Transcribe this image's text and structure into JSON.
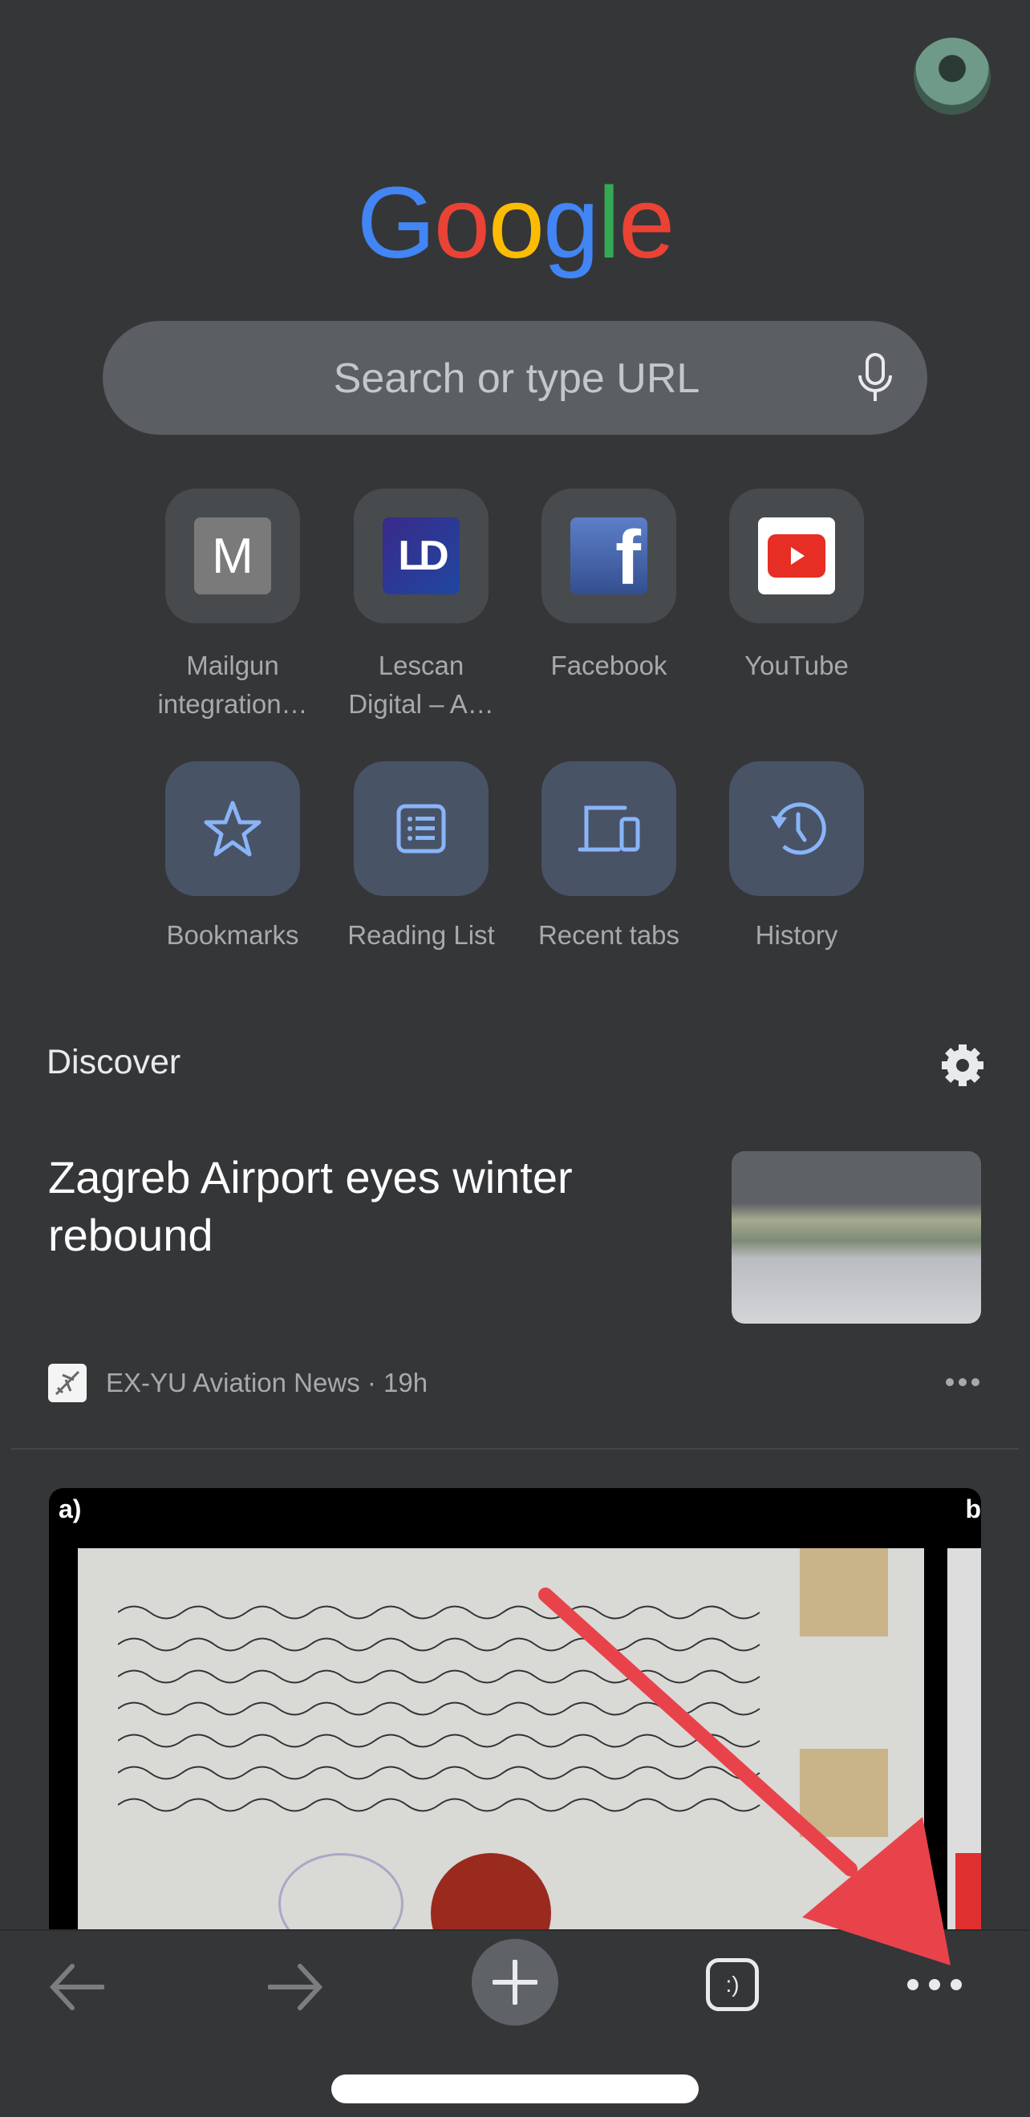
{
  "header": {
    "avatar_label": "Profile"
  },
  "logo": {
    "letters": [
      "G",
      "o",
      "o",
      "g",
      "l",
      "e"
    ],
    "colors": [
      "#4285f4",
      "#ea4335",
      "#fbbc05",
      "#4285f4",
      "#34a853",
      "#ea4335"
    ]
  },
  "search": {
    "placeholder": "Search or type URL",
    "icon": "microphone-icon"
  },
  "shortcuts": [
    {
      "label": "Mailgun integration…",
      "line1": "Mailgun",
      "line2": "integration…",
      "glyph": "M"
    },
    {
      "label": "Lescan Digital – A…",
      "line1": "Lescan",
      "line2": "Digital – A…",
      "glyph": "LD"
    },
    {
      "label": "Facebook",
      "line1": "Facebook",
      "line2": "",
      "glyph": "f"
    },
    {
      "label": "YouTube",
      "line1": "YouTube",
      "line2": "",
      "glyph": "youtube-play-icon"
    }
  ],
  "actions": [
    {
      "label": "Bookmarks",
      "icon": "star-icon"
    },
    {
      "label": "Reading List",
      "icon": "list-icon"
    },
    {
      "label": "Recent tabs",
      "icon": "devices-icon"
    },
    {
      "label": "History",
      "icon": "history-icon"
    }
  ],
  "discover": {
    "title": "Discover",
    "articles": [
      {
        "headline": "Zagreb Airport eyes winter rebound",
        "source": "EX-YU Aviation News",
        "age": "19h",
        "meta": "EX-YU Aviation News · 19h"
      }
    ],
    "card2_caption_a": "a)",
    "card2_caption_b": "b"
  },
  "toolbar": {
    "back": "back-arrow-icon",
    "forward": "forward-arrow-icon",
    "new_tab": "plus-icon",
    "tabs_glyph": ":)",
    "menu": "more-horizontal-icon"
  },
  "colors": {
    "background": "#353638",
    "accent": "#8ab4f8",
    "annotation_arrow": "#e8434b"
  }
}
